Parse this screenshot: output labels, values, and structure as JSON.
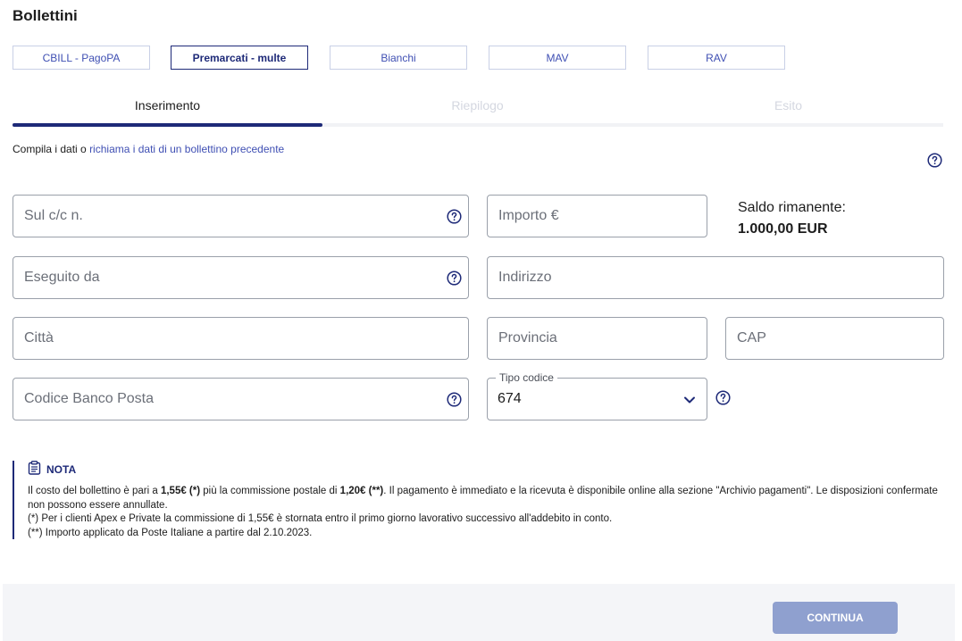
{
  "page": {
    "title": "Bollettini"
  },
  "tabs": [
    {
      "label": "CBILL - PagoPA",
      "active": false
    },
    {
      "label": "Premarcati - multe",
      "active": true
    },
    {
      "label": "Bianchi",
      "active": false
    },
    {
      "label": "MAV",
      "active": false
    },
    {
      "label": "RAV",
      "active": false
    }
  ],
  "steps": [
    {
      "label": "Inserimento",
      "state": "current"
    },
    {
      "label": "Riepilogo",
      "state": "future"
    },
    {
      "label": "Esito",
      "state": "future"
    }
  ],
  "intro": {
    "text": "Compila i dati o",
    "link": "richiama i dati di un bollettino precedente"
  },
  "form": {
    "account": {
      "placeholder": "Sul c/c n.",
      "value": ""
    },
    "amount": {
      "placeholder": "Importo €",
      "value": ""
    },
    "executed_by": {
      "placeholder": "Eseguito da",
      "value": ""
    },
    "address": {
      "placeholder": "Indirizzo",
      "value": ""
    },
    "city": {
      "placeholder": "Città",
      "value": ""
    },
    "province": {
      "placeholder": "Provincia",
      "value": ""
    },
    "cap": {
      "placeholder": "CAP",
      "value": ""
    },
    "bank_code": {
      "placeholder": "Codice Banco Posta",
      "value": ""
    },
    "code_type": {
      "label": "Tipo codice",
      "value": "674"
    }
  },
  "balance": {
    "label": "Saldo rimanente:",
    "value": "1.000,00 EUR"
  },
  "note": {
    "title": "NOTA",
    "line1_pre": "Il costo del bollettino è pari a ",
    "line1_fee": "1,55€ (*)",
    "line1_mid": " più la commissione postale di ",
    "line1_postal": "1,20€ (**)",
    "line1_post": ". Il pagamento è immediato e la ricevuta è disponibile online alla sezione \"Archivio pagamenti\". Le disposizioni confermate non possono essere annullate.",
    "line2": "(*) Per i clienti Apex e Private la commissione di 1,55€ è stornata entro il primo giorno lavorativo successivo all'addebito in conto.",
    "line3": "(**) Importo applicato da Poste Italiane a partire dal 2.10.2023."
  },
  "footer": {
    "continue_label": "CONTINUA"
  },
  "colors": {
    "primary": "#1e2a78",
    "link": "#3f4fb3",
    "disabled_button": "#8fa0cf",
    "inactive_step": "#d4d7e0"
  },
  "icons": {
    "help": "question-circle-icon",
    "chevron": "chevron-down-icon",
    "note": "clipboard-icon"
  }
}
